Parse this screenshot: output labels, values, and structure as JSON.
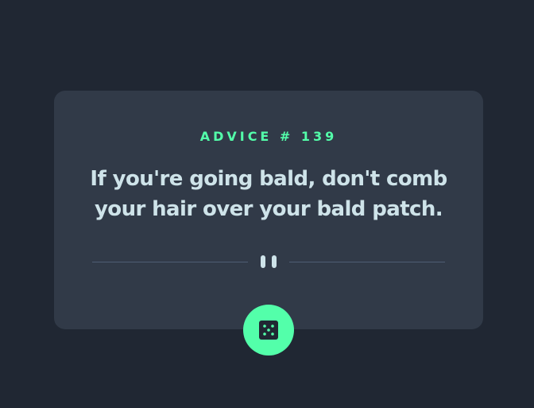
{
  "advice": {
    "id_label": "ADVICE # 139",
    "text": "If you're going bald, don't comb your hair over your bald patch."
  },
  "icons": {
    "divider": "pause-icon",
    "generate": "dice-icon"
  },
  "colors": {
    "background": "#202733",
    "card": "#313a48",
    "accent": "#53ffaa",
    "text": "#cee3e9",
    "divider": "#4f5d74"
  }
}
